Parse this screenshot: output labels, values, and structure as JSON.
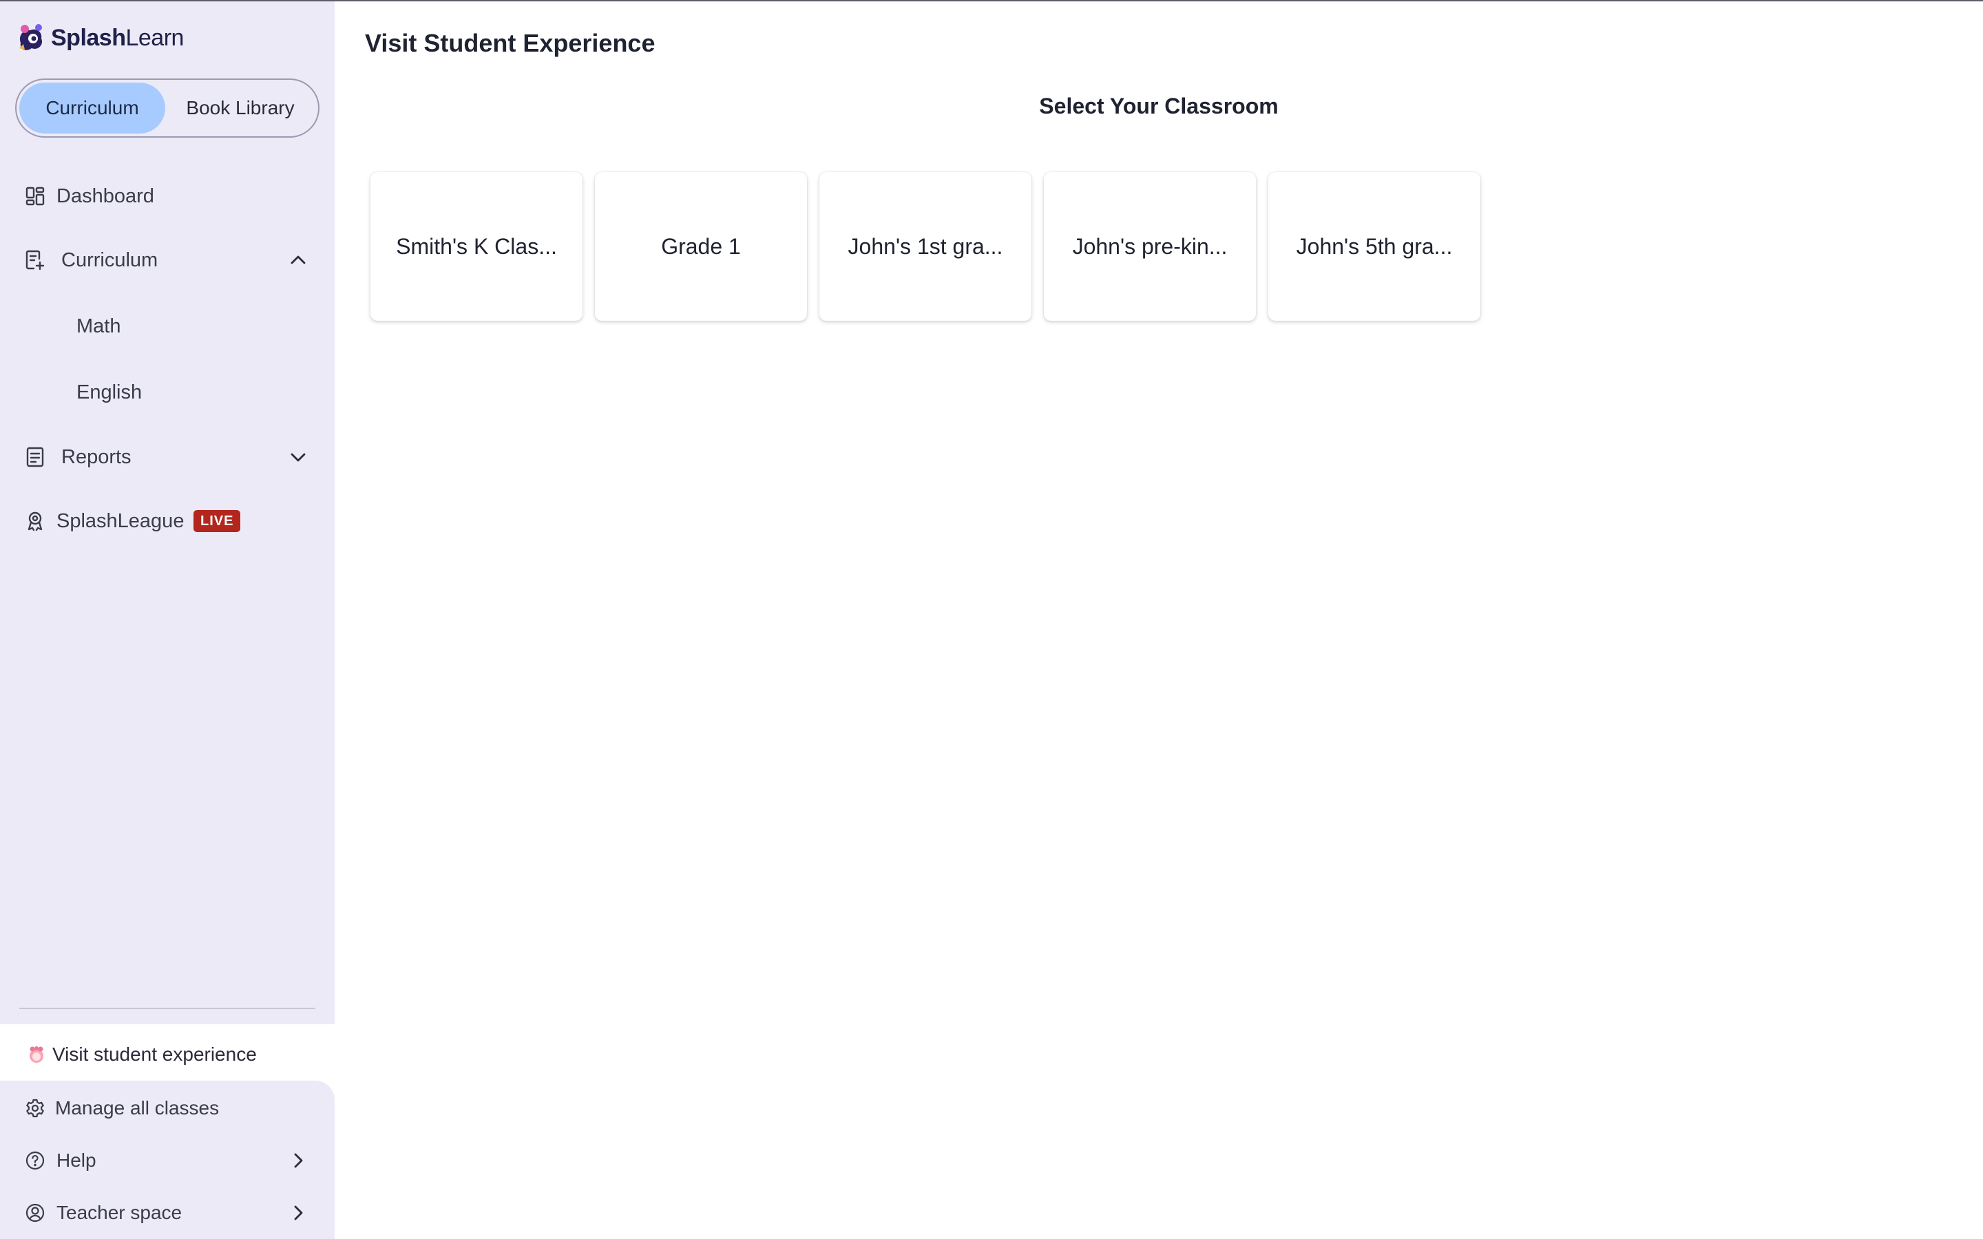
{
  "app": {
    "brand_part1": "Splash",
    "brand_part2": "Learn"
  },
  "segment": {
    "curriculum_label": "Curriculum",
    "book_library_label": "Book Library"
  },
  "sidebar": {
    "dashboard": "Dashboard",
    "curriculum": "Curriculum",
    "math": "Math",
    "english": "English",
    "reports": "Reports",
    "splashleague": "SplashLeague",
    "live_badge": "LIVE",
    "visit_student_experience": "Visit student experience",
    "manage_all_classes": "Manage all classes",
    "help": "Help",
    "teacher_space": "Teacher space"
  },
  "main": {
    "title": "Visit Student Experience",
    "section_title": "Select Your Classroom",
    "classrooms": [
      "Smith's K Clas...",
      "Grade 1",
      "John's 1st gra...",
      "John's pre-kin...",
      "John's 5th gra..."
    ]
  },
  "colors": {
    "sidebar_bg": "#eceaf6",
    "segment_active": "#a8cbff",
    "live_badge": "#b3261e",
    "brand_text": "#20214a"
  }
}
